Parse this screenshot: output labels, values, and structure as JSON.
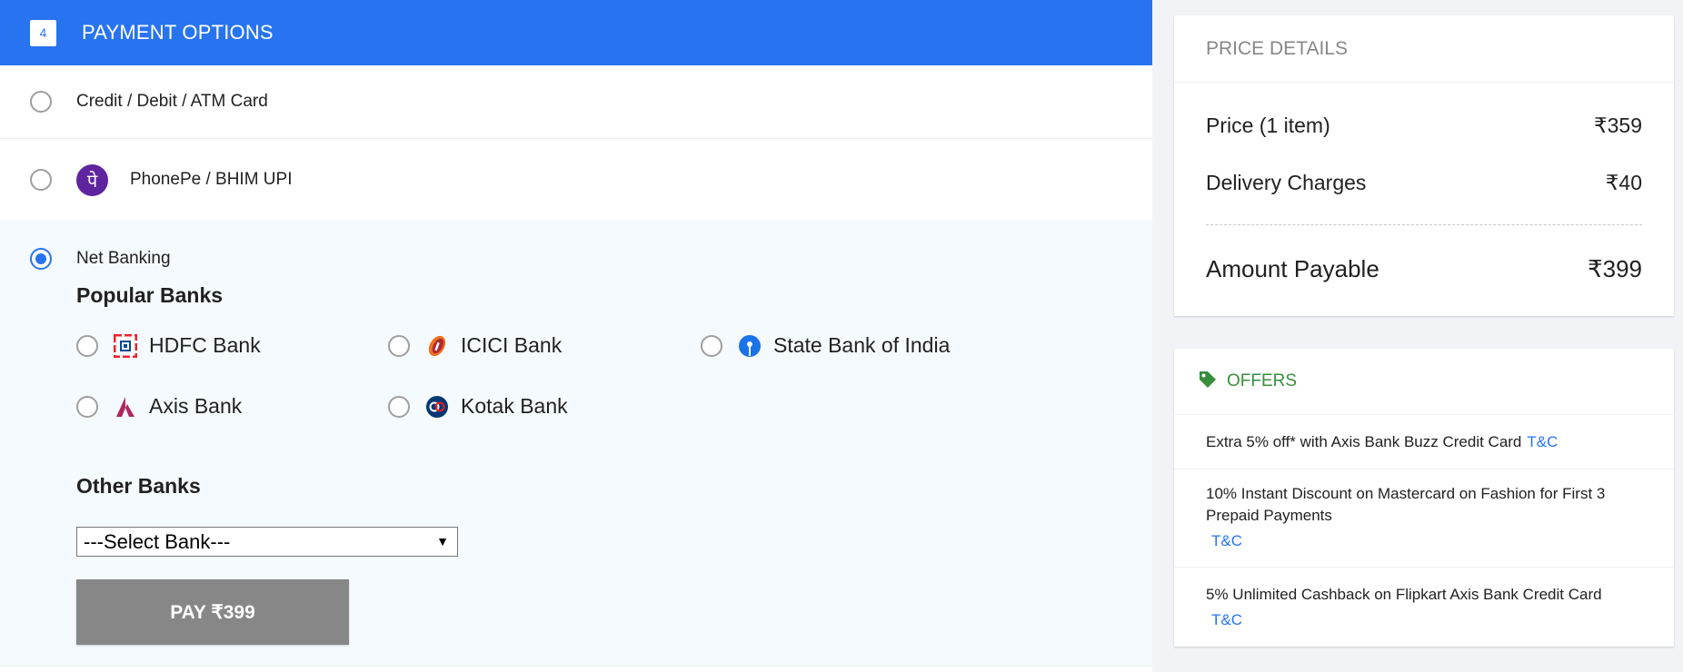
{
  "payment": {
    "step": "4",
    "title": "PAYMENT OPTIONS",
    "options": [
      {
        "label": "Credit / Debit / ATM Card",
        "selected": false
      },
      {
        "label": "PhonePe / BHIM UPI",
        "selected": false,
        "icon": "phonepe-icon",
        "icon_glyph": "पे"
      },
      {
        "label": "Net Banking",
        "selected": true
      }
    ],
    "popular_title": "Popular Banks",
    "banks": [
      {
        "name": "HDFC Bank",
        "icon": "hdfc-logo-icon"
      },
      {
        "name": "ICICI Bank",
        "icon": "icici-logo-icon"
      },
      {
        "name": "State Bank of India",
        "icon": "sbi-logo-icon"
      },
      {
        "name": "Axis Bank",
        "icon": "axis-logo-icon"
      },
      {
        "name": "Kotak Bank",
        "icon": "kotak-logo-icon"
      }
    ],
    "other_title": "Other Banks",
    "select_value": "---Select Bank---",
    "pay_button": "PAY ₹399"
  },
  "price": {
    "title": "PRICE DETAILS",
    "rows": [
      {
        "label": "Price (1 item)",
        "value": "₹359"
      },
      {
        "label": "Delivery Charges",
        "value": "₹40"
      }
    ],
    "total_label": "Amount Payable",
    "total_value": "₹399"
  },
  "offers": {
    "title": "OFFERS",
    "tc_label": "T&C",
    "items": [
      "Extra 5% off* with Axis Bank Buzz Credit Card",
      "10% Instant Discount on Mastercard on Fashion for First 3 Prepaid Payments",
      "5% Unlimited Cashback on Flipkart Axis Bank Credit Card"
    ]
  },
  "colors": {
    "accent": "#2874f0",
    "offers_green": "#388e3c",
    "phonepe": "#5f259f",
    "pay_button_disabled": "#878787"
  }
}
